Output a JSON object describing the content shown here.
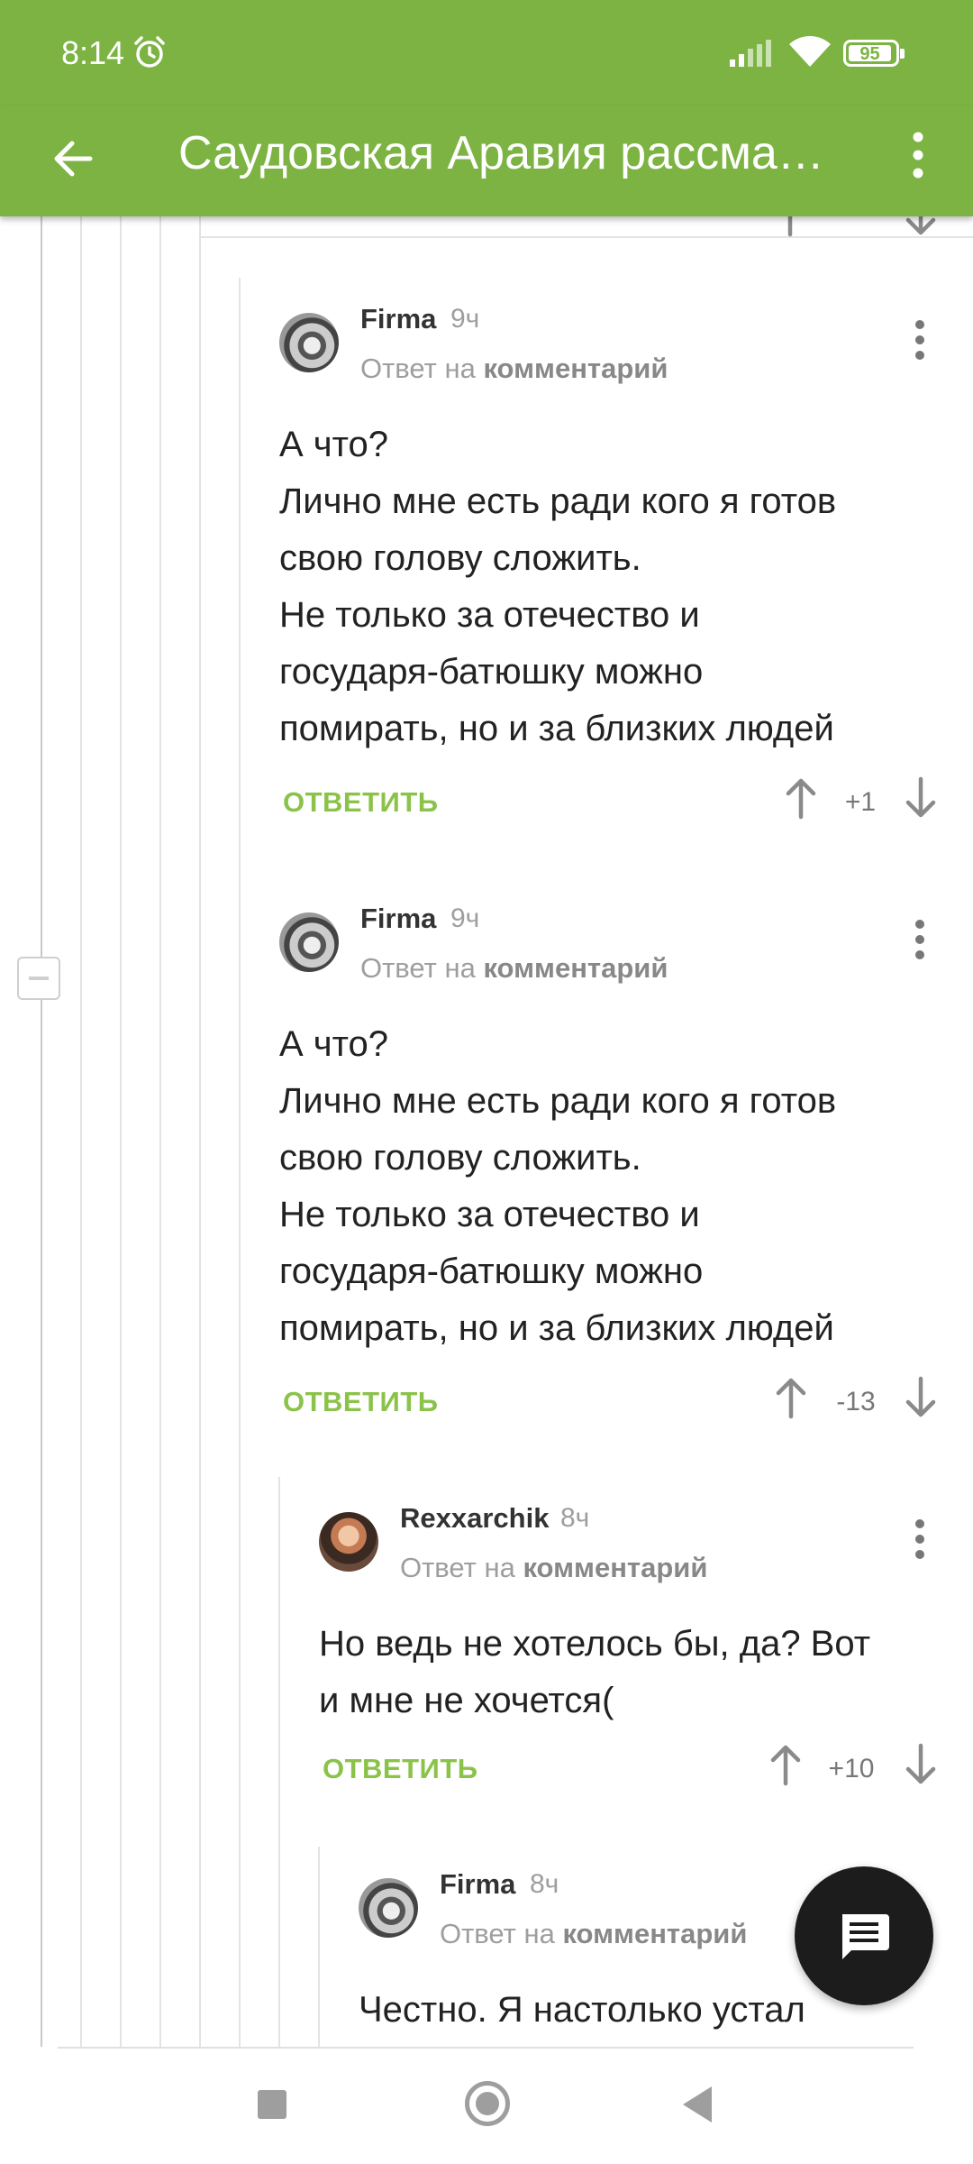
{
  "status_bar": {
    "time": "8:14",
    "battery": "95"
  },
  "app_bar": {
    "title": "Саудовская Аравия рассма…"
  },
  "comments": [
    {
      "author": "Firma",
      "time": "9ч",
      "reply_prefix": "Ответ на",
      "reply_link": "комментарий",
      "lines": [
        "А что?",
        "Лично мне есть ради кого я готов",
        "свою голову сложить.",
        "Не только за отечество и",
        "государя-батюшку можно",
        "помирать, но и за близких людей"
      ],
      "answer_label": "ОТВЕТИТЬ",
      "score": "+1"
    },
    {
      "author": "Firma",
      "time": "9ч",
      "reply_prefix": "Ответ на",
      "reply_link": "комментарий",
      "lines": [
        "А что?",
        "Лично мне есть ради кого я готов",
        "свою голову сложить.",
        "Не только за отечество и",
        "государя-батюшку можно",
        "помирать, но и за близких людей"
      ],
      "answer_label": "ОТВЕТИТЬ",
      "score": "-13"
    },
    {
      "author": "Rexxarchik",
      "time": "8ч",
      "reply_prefix": "Ответ на",
      "reply_link": "комментарий",
      "lines": [
        "Но ведь не хотелось бы, да? Вот",
        "и мне не хочется("
      ],
      "answer_label": "ОТВЕТИТЬ",
      "score": "+10"
    },
    {
      "author": "Firma",
      "time": "8ч",
      "reply_prefix": "Ответ на",
      "reply_link": "комментарий",
      "lines": [
        "Честно. Я настолько устал"
      ]
    }
  ],
  "icons": {
    "back": "arrow-left-icon",
    "more": "more-vertical-icon",
    "upvote": "arrow-up-icon",
    "downvote": "arrow-down-icon",
    "fab": "comment-icon"
  },
  "colors": {
    "accent": "#7cb342",
    "answer": "#8bc34a"
  }
}
